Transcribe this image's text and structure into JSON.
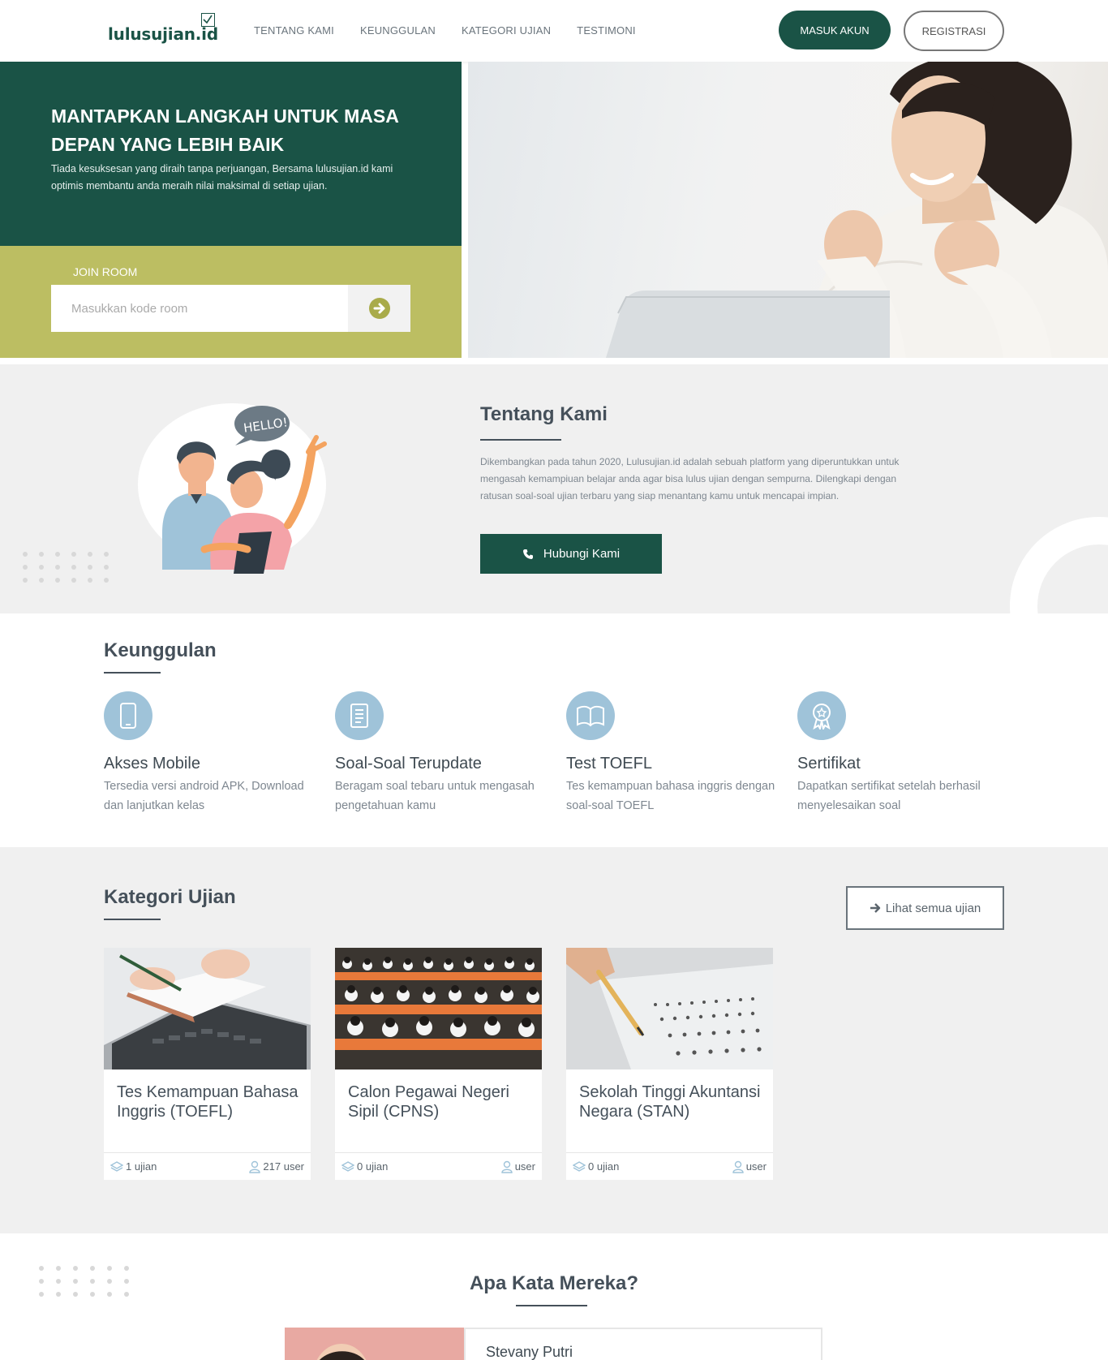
{
  "nav": {
    "logo": "lulusujian.id",
    "links": [
      "TENTANG KAMI",
      "KEUNGGULAN",
      "KATEGORI UJIAN",
      "TESTIMONI"
    ],
    "login": "MASUK AKUN",
    "register": "REGISTRASI"
  },
  "hero": {
    "title": "MANTAPKAN LANGKAH UNTUK MASA DEPAN YANG LEBIH BAIK",
    "text": "Tiada kesuksesan yang diraih tanpa perjuangan, Bersama lulusujian.id kami optimis membantu anda meraih nilai maksimal di setiap ujian.",
    "join_label": "JOIN ROOM",
    "join_placeholder": "Masukkan kode room"
  },
  "about": {
    "bubble": "HELLO!",
    "title": "Tentang Kami",
    "text": "Dikembangkan pada tahun 2020, Lulusujian.id adalah sebuah platform yang diperuntukkan untuk mengasah kemampiuan belajar anda agar bisa lulus ujian dengan sempurna. Dilengkapi dengan ratusan soal-soal ujian terbaru yang siap menantang kamu untuk mencapai impian.",
    "button": "Hubungi Kami"
  },
  "features": {
    "title": "Keunggulan",
    "items": [
      {
        "icon": "mobile-icon",
        "title": "Akses Mobile",
        "text": "Tersedia versi android APK, Download dan lanjutkan kelas"
      },
      {
        "icon": "document-icon",
        "title": "Soal-Soal Terupdate",
        "text": "Beragam soal tebaru untuk mengasah pengetahuan kamu"
      },
      {
        "icon": "book-icon",
        "title": "Test TOEFL",
        "text": "Tes kemampuan bahasa inggris dengan soal-soal TOEFL"
      },
      {
        "icon": "award-icon",
        "title": "Sertifikat",
        "text": "Dapatkan sertifikat setelah berhasil menyelesaikan soal"
      }
    ]
  },
  "categories": {
    "title": "Kategori Ujian",
    "all_button": "Lihat semua ujian",
    "cards": [
      {
        "title": "Tes Kemampuan Bahasa Inggris (TOEFL)",
        "exams": "1 ujian",
        "users": "217 user"
      },
      {
        "title": "Calon Pegawai Negeri Sipil (CPNS)",
        "exams": "0 ujian",
        "users": "user"
      },
      {
        "title": "Sekolah Tinggi Akuntansi Negara (STAN)",
        "exams": "0 ujian",
        "users": "user"
      }
    ]
  },
  "testimonials": {
    "title": "Apa Kata Mereka?",
    "name": "Stevany Putri"
  },
  "colors": {
    "primary": "#1a5346",
    "olive": "#bcbe62",
    "icon_blue": "#9fc3d9",
    "gray_bg": "#f0f0f0"
  }
}
